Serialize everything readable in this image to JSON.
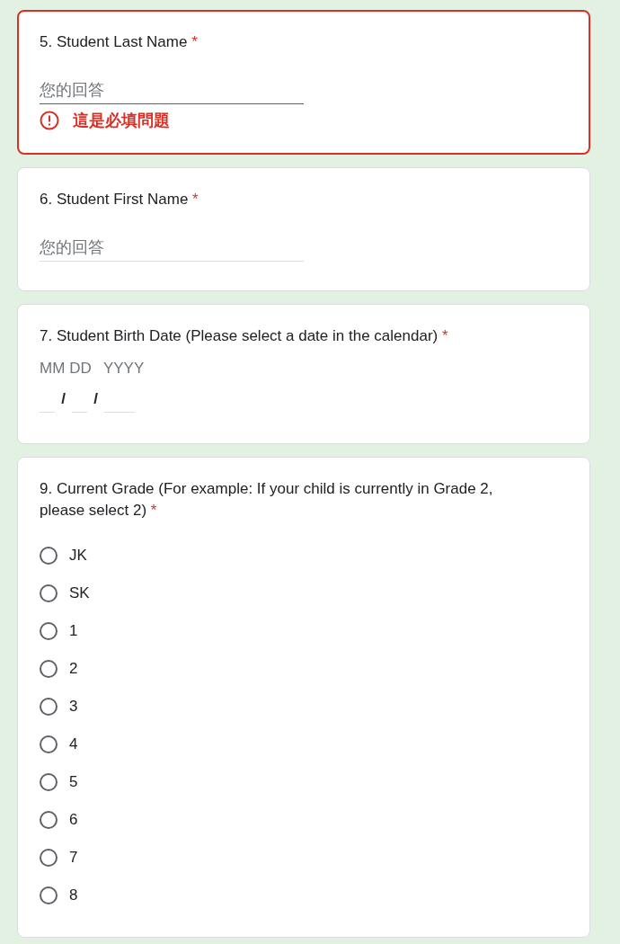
{
  "questions": [
    {
      "kind": "short_answer",
      "title": "5. Student Last Name",
      "required_mark": "*",
      "error": true,
      "placeholder": "您的回答",
      "error_message": "這是必填問題"
    },
    {
      "kind": "short_answer",
      "title": "6. Student First Name",
      "required_mark": "*",
      "error": false,
      "placeholder": "您的回答"
    },
    {
      "kind": "date",
      "title": "7. Student Birth Date (Please select a date in the calendar)",
      "required_mark": "*",
      "error": false,
      "fields": [
        {
          "label": "MM"
        },
        {
          "label": "DD"
        },
        {
          "label": "YYYY"
        }
      ],
      "separators": [
        "/",
        "/"
      ]
    },
    {
      "kind": "multiple_choice",
      "title": "9. Current Grade (For example: If your child is currently in Grade 2, please select 2)",
      "required_mark": "*",
      "error": false,
      "options": [
        {
          "label": "JK",
          "selected": false
        },
        {
          "label": "SK",
          "selected": false
        },
        {
          "label": "1",
          "selected": false
        },
        {
          "label": "2",
          "selected": false
        },
        {
          "label": "3",
          "selected": false
        },
        {
          "label": "4",
          "selected": false
        },
        {
          "label": "5",
          "selected": false
        },
        {
          "label": "6",
          "selected": false
        },
        {
          "label": "7",
          "selected": false
        },
        {
          "label": "8",
          "selected": false
        }
      ]
    }
  ]
}
